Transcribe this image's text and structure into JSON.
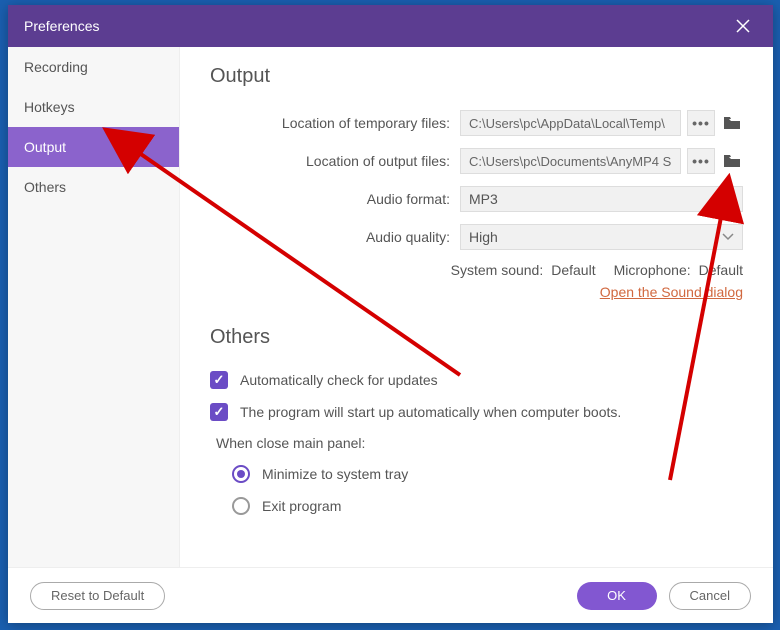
{
  "titlebar": {
    "title": "Preferences"
  },
  "sidebar": {
    "items": [
      {
        "label": "Recording",
        "selected": false
      },
      {
        "label": "Hotkeys",
        "selected": false
      },
      {
        "label": "Output",
        "selected": true
      },
      {
        "label": "Others",
        "selected": false
      }
    ]
  },
  "output": {
    "heading": "Output",
    "temp_label": "Location of temporary files:",
    "temp_value": "C:\\Users\\pc\\AppData\\Local\\Temp\\",
    "out_label": "Location of output files:",
    "out_value": "C:\\Users\\pc\\Documents\\AnyMP4 S",
    "format_label": "Audio format:",
    "format_value": "MP3",
    "quality_label": "Audio quality:",
    "quality_value": "High",
    "system_sound_label": "System sound:",
    "system_sound_value": "Default",
    "mic_label": "Microphone:",
    "mic_value": "Default",
    "sound_link": "Open the Sound dialog"
  },
  "others": {
    "heading": "Others",
    "check_updates": "Automatically check for updates",
    "autostart": "The program will start up automatically when computer boots.",
    "close_label": "When close main panel:",
    "radio_minimize": "Minimize to system tray",
    "radio_exit": "Exit program"
  },
  "footer": {
    "reset": "Reset to Default",
    "ok": "OK",
    "cancel": "Cancel"
  }
}
